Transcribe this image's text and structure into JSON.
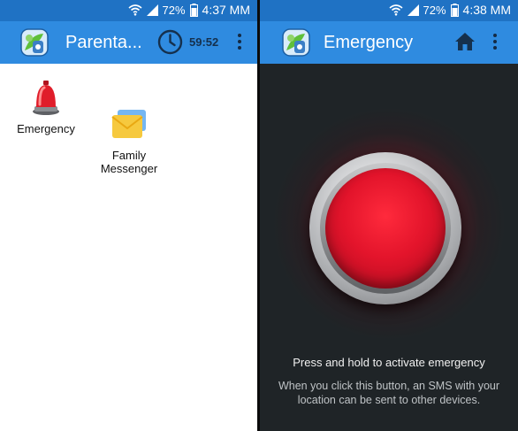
{
  "left_screen": {
    "status_bar": {
      "battery": "72%",
      "time": "4:37 MM"
    },
    "app_bar": {
      "title": "Parenta...",
      "timer": "59:52"
    },
    "launcher": {
      "items": [
        {
          "label": "Emergency",
          "icon": "siren-icon"
        },
        {
          "label": "Family\nMessenger",
          "icon": "envelope-icon"
        }
      ]
    }
  },
  "right_screen": {
    "status_bar": {
      "battery": "72%",
      "time": "4:38 MM"
    },
    "app_bar": {
      "title": "Emergency"
    },
    "emergency": {
      "button_icon": "emergency-button",
      "instruction": "Press and hold to activate emergency",
      "description": "When you click this button, an SMS with your location can be sent to other devices."
    }
  },
  "colors": {
    "status_bar": "#1f72c4",
    "app_bar": "#2f8be0",
    "emergency_bg": "#1f2427",
    "button_red": "#e3142b"
  }
}
